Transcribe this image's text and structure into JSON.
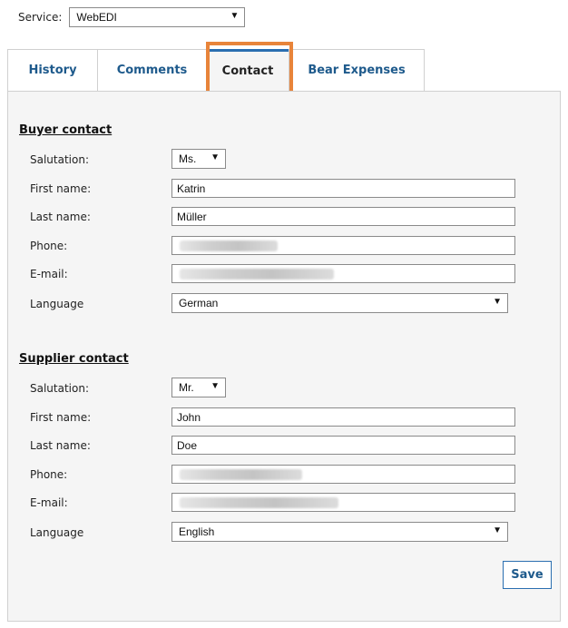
{
  "service": {
    "label": "Service:",
    "value": "WebEDI"
  },
  "tabs": [
    {
      "label": "History"
    },
    {
      "label": "Comments"
    },
    {
      "label": "Contact",
      "active": true
    },
    {
      "label": "Bear Expenses"
    }
  ],
  "buyer": {
    "title": "Buyer contact",
    "salutation_label": "Salutation:",
    "salutation": "Ms.",
    "first_name_label": "First name:",
    "first_name": "Katrin",
    "last_name_label": "Last name:",
    "last_name": "Müller",
    "phone_label": "Phone:",
    "email_label": "E-mail:",
    "language_label": "Language",
    "language": "German"
  },
  "supplier": {
    "title": "Supplier contact",
    "salutation_label": "Salutation:",
    "salutation": "Mr.",
    "first_name_label": "First name:",
    "first_name": "John",
    "last_name_label": "Last name:",
    "last_name": "Doe",
    "phone_label": "Phone:",
    "email_label": "E-mail:",
    "language_label": "Language",
    "language": "English"
  },
  "actions": {
    "save_label": "Save"
  },
  "icons": {
    "dropdown": "dropdown-arrow-icon"
  },
  "colors": {
    "accent": "#1e5a8c",
    "highlight": "#e8843a",
    "panel_bg": "#f5f5f5"
  }
}
